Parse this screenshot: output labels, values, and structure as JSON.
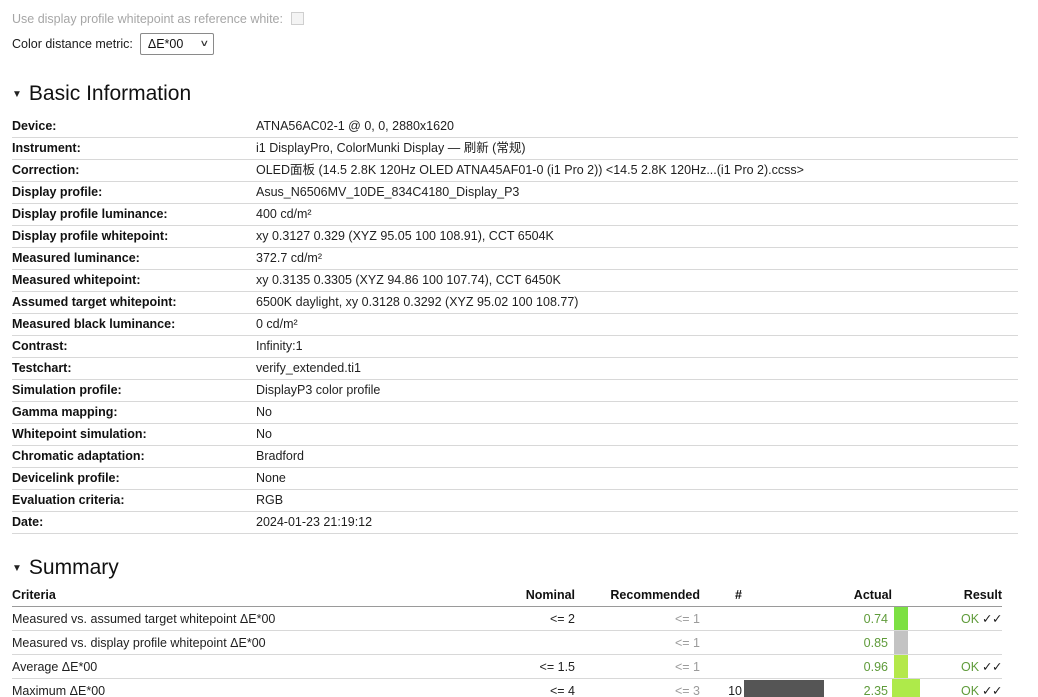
{
  "options": {
    "whitepoint_reference": {
      "label": "Use display profile whitepoint as reference white:",
      "checked": false,
      "disabled": true
    },
    "color_distance_metric": {
      "label": "Color distance metric:",
      "value": "ΔE*00",
      "chevron": "∨"
    }
  },
  "basic_information": {
    "title": "Basic Information",
    "triangle": "▼",
    "rows": [
      {
        "key": "Device:",
        "value": "ATNA56AC02-1 @ 0, 0, 2880x1620"
      },
      {
        "key": "Instrument:",
        "value": "i1 DisplayPro, ColorMunki Display — 刷新 (常规)"
      },
      {
        "key": "Correction:",
        "value": "OLED面板 (14.5 2.8K 120Hz OLED ATNA45AF01-0 (i1 Pro 2)) <14.5 2.8K 120Hz...(i1 Pro 2).ccss>"
      },
      {
        "key": "Display profile:",
        "value": "Asus_N6506MV_10DE_834C4180_Display_P3"
      },
      {
        "key": "Display profile luminance:",
        "value": "400 cd/m²"
      },
      {
        "key": "Display profile whitepoint:",
        "value": "xy 0.3127 0.329 (XYZ 95.05 100 108.91), CCT 6504K"
      },
      {
        "key": "Measured luminance:",
        "value": "372.7 cd/m²"
      },
      {
        "key": "Measured whitepoint:",
        "value": "xy 0.3135 0.3305 (XYZ 94.86 100 107.74), CCT 6450K"
      },
      {
        "key": "Assumed target whitepoint:",
        "value": "6500K daylight, xy 0.3128 0.3292 (XYZ 95.02 100 108.77)"
      },
      {
        "key": "Measured black luminance:",
        "value": "0 cd/m²"
      },
      {
        "key": "Contrast:",
        "value": "Infinity:1"
      },
      {
        "key": "Testchart:",
        "value": "verify_extended.ti1"
      },
      {
        "key": "Simulation profile:",
        "value": "DisplayP3 color profile"
      },
      {
        "key": "Gamma mapping:",
        "value": "No"
      },
      {
        "key": "Whitepoint simulation:",
        "value": "No"
      },
      {
        "key": "Chromatic adaptation:",
        "value": "Bradford"
      },
      {
        "key": "Devicelink profile:",
        "value": "None"
      },
      {
        "key": "Evaluation criteria:",
        "value": "RGB"
      },
      {
        "key": "Date:",
        "value": "2024-01-23 21:19:12"
      }
    ]
  },
  "summary": {
    "title": "Summary",
    "triangle": "▼",
    "columns": {
      "criteria": "Criteria",
      "nominal": "Nominal",
      "recommended": "Recommended",
      "count": "#",
      "actual": "Actual",
      "result": "Result"
    },
    "rows": [
      {
        "criteria": "Measured vs. assumed target whitepoint ΔE*00",
        "nominal": "<= 2",
        "recommended": "<= 1",
        "count": "",
        "swatch": "",
        "actual": "0.74",
        "bar_color": "#7ce043",
        "bar_wide": false,
        "result": "OK",
        "ticks": "✓✓"
      },
      {
        "criteria": "Measured vs. display profile whitepoint ΔE*00",
        "nominal": "",
        "recommended": "<= 1",
        "count": "",
        "swatch": "",
        "actual": "0.85",
        "bar_color": "#c3c3c3",
        "bar_wide": false,
        "result": "",
        "ticks": ""
      },
      {
        "criteria": "Average ΔE*00",
        "nominal": "<= 1.5",
        "recommended": "<= 1",
        "count": "",
        "swatch": "",
        "actual": "0.96",
        "bar_color": "#b4e84a",
        "bar_wide": false,
        "result": "OK",
        "ticks": "✓✓"
      },
      {
        "criteria": "Maximum ΔE*00",
        "nominal": "<= 4",
        "recommended": "<= 3",
        "count": "10",
        "swatch": "#555555",
        "actual": "2.35",
        "bar_color": "#aeea4a",
        "bar_wide": true,
        "result": "OK",
        "ticks": "✓✓"
      }
    ]
  }
}
